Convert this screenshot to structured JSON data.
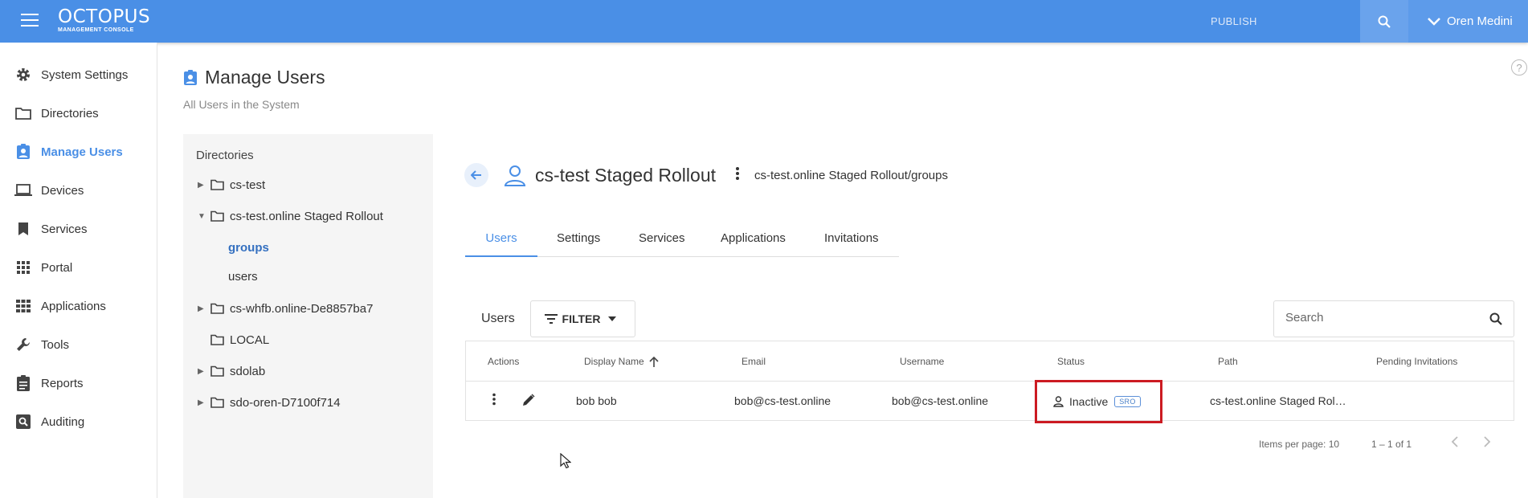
{
  "app": {
    "logo_main": "OCTOPUS",
    "logo_sub": "MANAGEMENT CONSOLE",
    "publish_label": "PUBLISH",
    "user_name": "Oren Medini",
    "brand_color": "#4a8fe6"
  },
  "sidebar": {
    "items": [
      {
        "label": "System Settings",
        "icon": "gear-icon"
      },
      {
        "label": "Directories",
        "icon": "folder-icon"
      },
      {
        "label": "Manage Users",
        "icon": "user-badge-icon",
        "active": true
      },
      {
        "label": "Devices",
        "icon": "laptop-icon"
      },
      {
        "label": "Services",
        "icon": "bookmark-icon"
      },
      {
        "label": "Portal",
        "icon": "grid-icon"
      },
      {
        "label": "Applications",
        "icon": "apps-icon"
      },
      {
        "label": "Tools",
        "icon": "wrench-icon"
      },
      {
        "label": "Reports",
        "icon": "clipboard-icon"
      },
      {
        "label": "Auditing",
        "icon": "search-box-icon"
      }
    ]
  },
  "page": {
    "title": "Manage Users",
    "subtitle": "All Users in the System",
    "help": "?"
  },
  "tree": {
    "title": "Directories",
    "nodes": [
      {
        "label": "cs-test",
        "arrow": "▶"
      },
      {
        "label": "cs-test.online Staged Rollout",
        "arrow": "▼"
      },
      {
        "label": "cs-whfb.online-De8857ba7",
        "arrow": "▶"
      },
      {
        "label": "LOCAL",
        "arrow": ""
      },
      {
        "label": "sdolab",
        "arrow": "▶"
      },
      {
        "label": "sdo-oren-D7100f714",
        "arrow": "▶"
      }
    ],
    "children": [
      {
        "label": "groups",
        "selected": true
      },
      {
        "label": "users",
        "selected": false
      }
    ]
  },
  "group": {
    "title": "cs-test Staged Rollout",
    "path": "cs-test.online Staged Rollout/groups"
  },
  "tabs": [
    {
      "label": "Users",
      "active": true
    },
    {
      "label": "Settings"
    },
    {
      "label": "Services"
    },
    {
      "label": "Applications"
    },
    {
      "label": "Invitations"
    }
  ],
  "toolbar": {
    "users_label": "Users",
    "filter_label": "FILTER",
    "search_placeholder": "Search"
  },
  "table": {
    "headers": [
      "Actions",
      "Display Name",
      "Email",
      "Username",
      "Status",
      "Path",
      "Pending Invitations"
    ],
    "rows": [
      {
        "display_name": "bob bob",
        "email": "bob@cs-test.online",
        "username": "bob@cs-test.online",
        "status": "Inactive",
        "badge": "SRO",
        "path": "cs-test.online Staged Rol…",
        "pending": ""
      }
    ]
  },
  "pagination": {
    "items_per_page": "Items per page: 10",
    "range": "1 – 1 of 1"
  }
}
